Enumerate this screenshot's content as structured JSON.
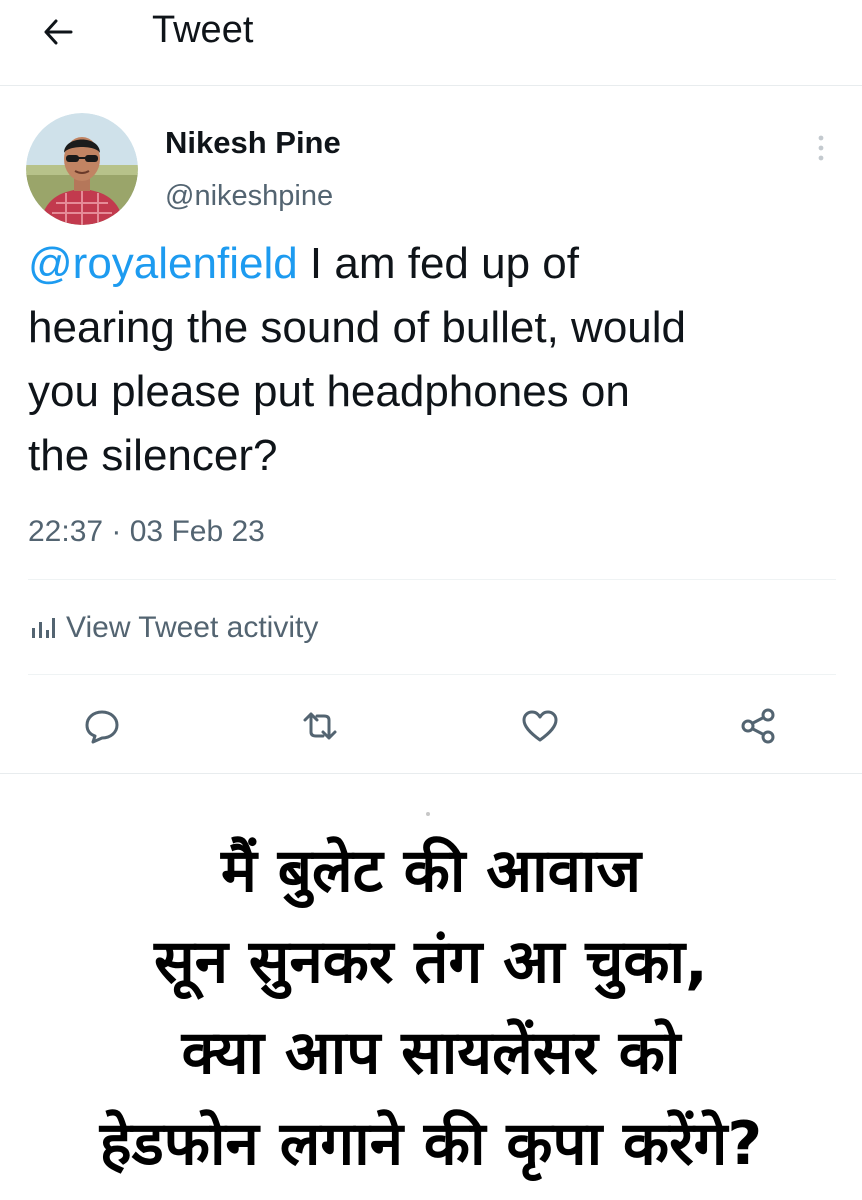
{
  "header": {
    "back_icon": "arrow-left-icon",
    "title": "Tweet"
  },
  "author": {
    "display_name": "Nikesh Pine",
    "handle": "@nikeshpine",
    "avatar_icon": "profile-photo",
    "more_icon": "vertical-ellipsis-icon"
  },
  "tweet": {
    "mention": "@royalenfield",
    "text_lines": [
      " I am fed up of",
      "hearing the sound of bullet, would",
      "you please put headphones on",
      "the silencer?"
    ],
    "timestamp": "22:37 · 03 Feb 23"
  },
  "activity": {
    "icon": "bar-chart-icon",
    "label": "View Tweet activity"
  },
  "actions": {
    "reply_icon": "reply-icon",
    "retweet_icon": "retweet-icon",
    "like_icon": "heart-icon",
    "share_icon": "share-icon"
  },
  "caption": {
    "lines": [
      "मैं बुलेट की आवाज",
      "सून सुनकर तंग आ चुका,",
      "क्या आप सायलेंसर को",
      "हेडफोन लगाने की कृपा करेंगे?"
    ]
  },
  "colors": {
    "link": "#1d9bf0",
    "text": "#0f1419",
    "secondary": "#536471",
    "border": "#eff3f4"
  }
}
